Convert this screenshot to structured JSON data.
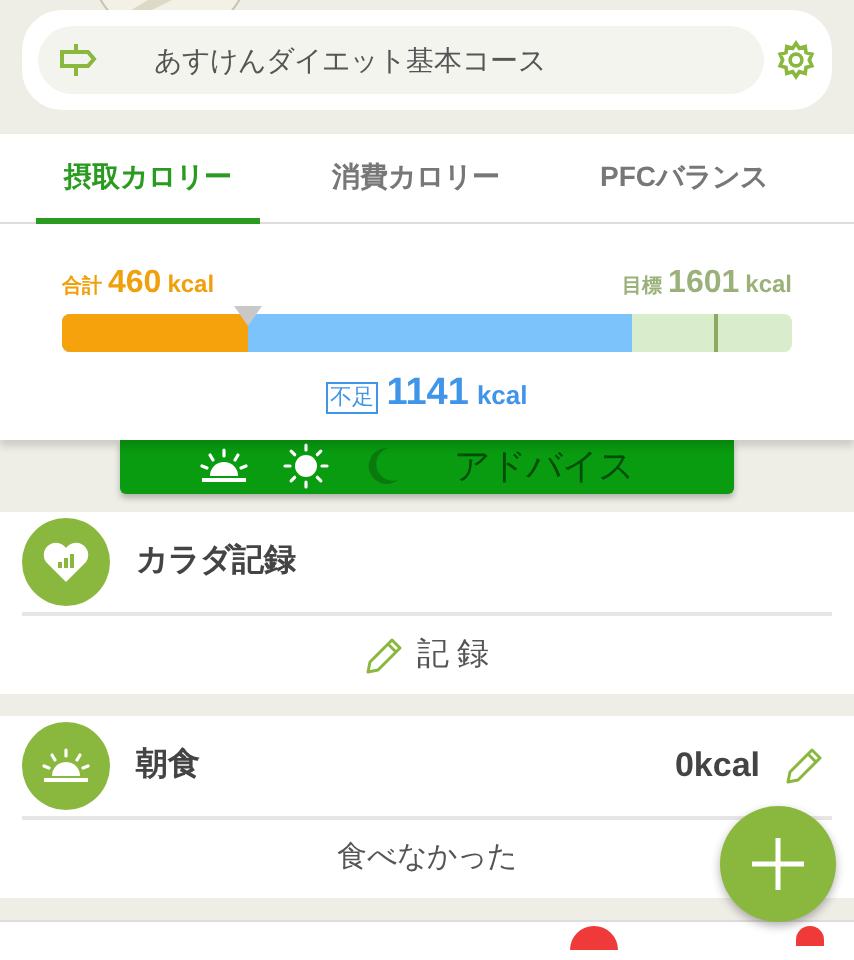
{
  "course": {
    "title": "あすけんダイエット基本コース"
  },
  "tabs": [
    {
      "label": "摂取カロリー",
      "selected": true
    },
    {
      "label": "消費カロリー",
      "selected": false
    },
    {
      "label": "PFCバランス",
      "selected": false
    }
  ],
  "calories": {
    "total_label": "合計",
    "total_value": "460",
    "total_unit": "kcal",
    "target_label": "目標",
    "target_value": "1601",
    "target_unit": "kcal",
    "bar": [
      {
        "kind": "shortage",
        "level": 0.78
      },
      {
        "kind": "intake",
        "level": 0.255
      }
    ],
    "target_marker": {
      "level": 0.893
    },
    "shortage_label": "不足",
    "shortage_value": "1141",
    "shortage_unit": "kcal"
  },
  "advice": {
    "label": "アドバイス",
    "meals": [
      {
        "kind": "sunrise",
        "done": true
      },
      {
        "kind": "sun",
        "done": true
      },
      {
        "kind": "moon",
        "done": false
      }
    ]
  },
  "sections": [
    {
      "kind": "body",
      "title": "カラダ記録",
      "action": "記 録"
    },
    {
      "kind": "breakfast",
      "title": "朝食",
      "kcal": "0kcal",
      "note": "食べなかった"
    }
  ]
}
